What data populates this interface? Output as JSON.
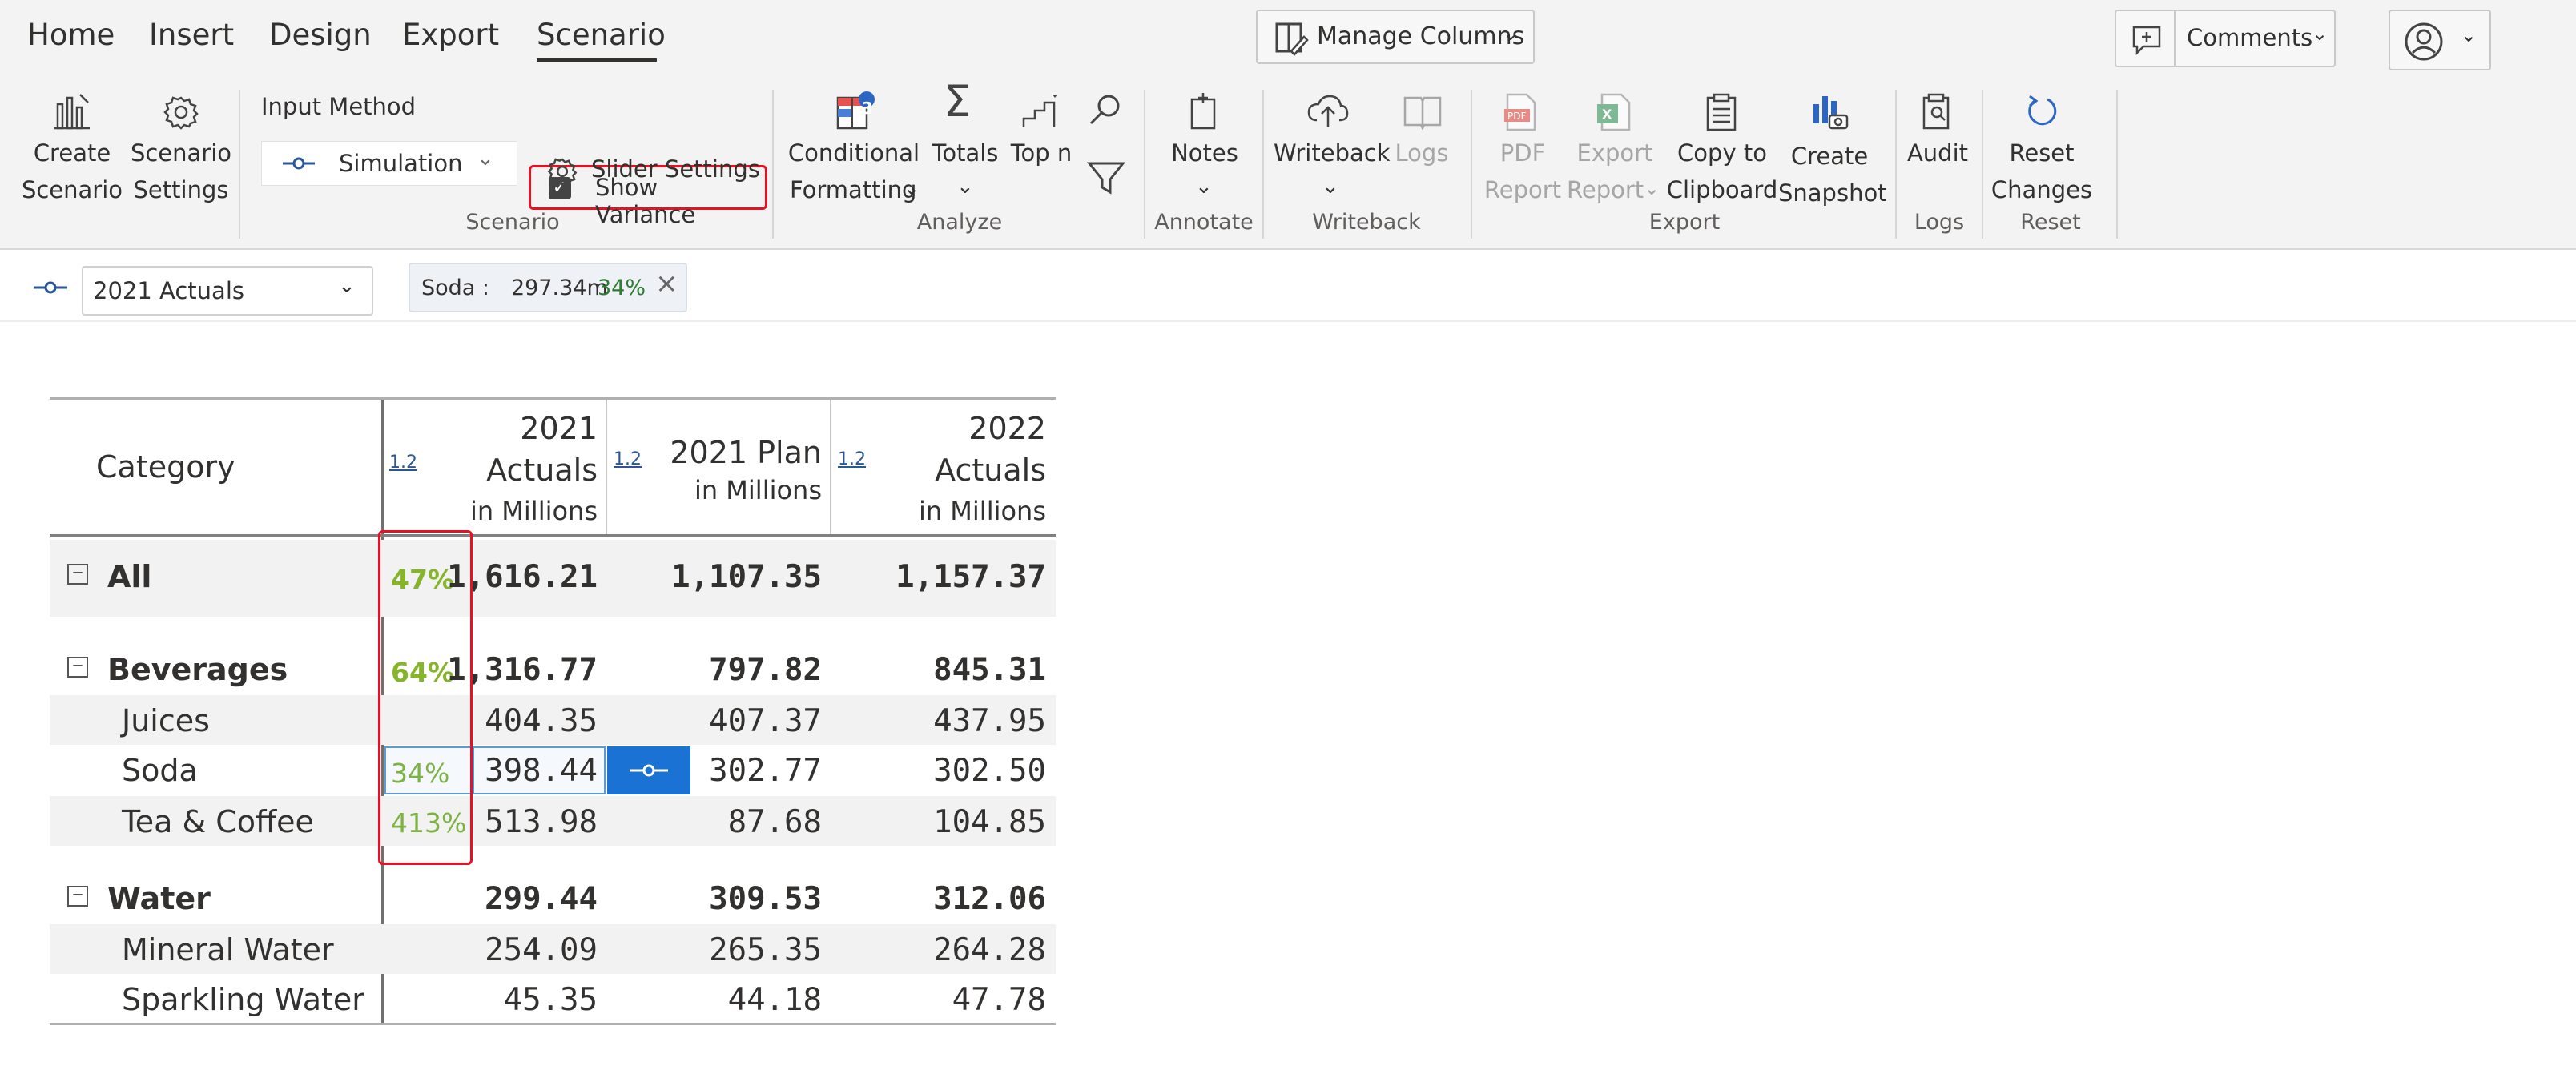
{
  "menu": {
    "tabs": [
      "Home",
      "Insert",
      "Design",
      "Export",
      "Scenario"
    ],
    "active_tab": "Scenario",
    "manage_columns": "Manage Columns",
    "comments": "Comments"
  },
  "ribbon": {
    "scenario_group": {
      "label": "Scenario",
      "create_scenario": [
        "Create",
        "Scenario"
      ],
      "scenario_settings": [
        "Scenario",
        "Settings"
      ],
      "input_method_label": "Input Method",
      "input_method_value": "Simulation",
      "show_variance": "Show Variance",
      "show_variance_checked": true,
      "slider_settings": "Slider Settings"
    },
    "analyze_group": {
      "label": "Analyze",
      "conditional_formatting": [
        "Conditional",
        "Formatting"
      ],
      "conditional_badge": "3",
      "totals": "Totals",
      "top_n": "Top n"
    },
    "annotate_group": {
      "label": "Annotate",
      "notes": "Notes"
    },
    "writeback_group": {
      "label": "Writeback",
      "writeback": "Writeback",
      "logs": "Logs"
    },
    "export_group": {
      "label": "Export",
      "pdf_report": [
        "PDF",
        "Report"
      ],
      "export_report": [
        "Export",
        "Report"
      ],
      "copy_to_clipboard": [
        "Copy to",
        "Clipboard"
      ],
      "create_snapshot": [
        "Create",
        "Snapshot"
      ]
    },
    "logs_group": {
      "label": "Logs",
      "audit": "Audit"
    },
    "reset_group": {
      "label": "Reset",
      "reset_changes": [
        "Reset",
        "Changes"
      ]
    }
  },
  "scenario_bar": {
    "scenario": "2021 Actuals",
    "chip_label": "Soda :",
    "chip_value": "297.34m",
    "chip_pct": "34%"
  },
  "table": {
    "header": {
      "category": "Category",
      "scale": "1.2",
      "col1": [
        "2021",
        "Actuals",
        "in Millions"
      ],
      "col2": [
        "2021 Plan",
        "in Millions"
      ],
      "col3": [
        "2022",
        "Actuals",
        "in Millions"
      ]
    },
    "rows": [
      {
        "label": "All",
        "level": 0,
        "bold": true,
        "collapse": "−",
        "var": "47%",
        "c1": "1,616.21",
        "c2": "1,107.35",
        "c3": "1,157.37"
      },
      {
        "label": "Beverages",
        "level": 0,
        "bold": true,
        "collapse": "−",
        "var": "64%",
        "c1": "1,316.77",
        "c2": "797.82",
        "c3": "845.31"
      },
      {
        "label": "Juices",
        "level": 1,
        "bold": false,
        "var": "",
        "c1": "404.35",
        "c2": "407.37",
        "c3": "437.95"
      },
      {
        "label": "Soda",
        "level": 1,
        "bold": false,
        "var": "34%",
        "c1": "398.44",
        "c2": "302.77",
        "c3": "302.50"
      },
      {
        "label": "Tea & Coffee",
        "level": 1,
        "bold": false,
        "var": "413%",
        "c1": "513.98",
        "c2": "87.68",
        "c3": "104.85"
      },
      {
        "label": "Water",
        "level": 0,
        "bold": true,
        "collapse": "−",
        "var": "",
        "c1": "299.44",
        "c2": "309.53",
        "c3": "312.06"
      },
      {
        "label": "Mineral Water",
        "level": 1,
        "bold": false,
        "var": "",
        "c1": "254.09",
        "c2": "265.35",
        "c3": "264.28"
      },
      {
        "label": "Sparkling Water",
        "level": 1,
        "bold": false,
        "var": "",
        "c1": "45.35",
        "c2": "44.18",
        "c3": "47.78"
      }
    ]
  }
}
